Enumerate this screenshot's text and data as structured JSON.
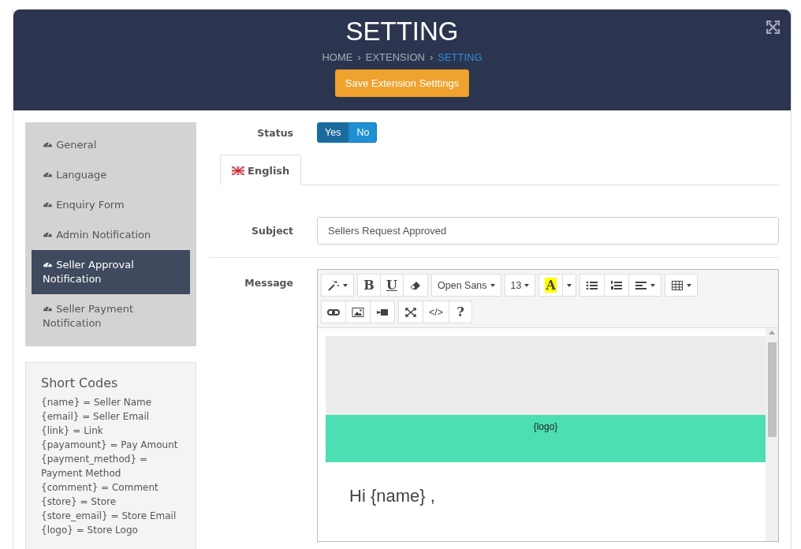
{
  "header": {
    "title": "SETTING",
    "separator": "›",
    "breadcrumb": [
      {
        "label": "HOME",
        "current": false
      },
      {
        "label": "EXTENSION",
        "current": false
      },
      {
        "label": "SETTING",
        "current": true
      }
    ],
    "save_button": "Save Extension Setttings"
  },
  "sidebar": {
    "items": [
      {
        "label": "General",
        "selected": false
      },
      {
        "label": "Language",
        "selected": false
      },
      {
        "label": "Enquiry Form",
        "selected": false
      },
      {
        "label": "Admin Notification",
        "selected": false
      },
      {
        "label": "Seller Approval Notification",
        "selected": true
      },
      {
        "label": "Seller Payment Notification",
        "selected": false
      }
    ]
  },
  "short_codes": {
    "title": "Short Codes",
    "lines": [
      "{name} = Seller Name",
      "{email} = Seller Email",
      "{link} = Link",
      "{payamount} = Pay Amount",
      "{payment_method} = Payment Method",
      "{comment} = Comment",
      "{store} = Store",
      "{store_email} = Store Email",
      "{logo} = Store Logo"
    ]
  },
  "status": {
    "label": "Status",
    "options": [
      {
        "label": "Yes",
        "selected": true
      },
      {
        "label": "No",
        "selected": false
      }
    ]
  },
  "language_tabs": [
    {
      "label": "English",
      "selected": true
    }
  ],
  "subject": {
    "label": "Subject",
    "value": "Sellers Request Approved"
  },
  "message": {
    "label": "Message",
    "toolbar": [
      [
        {
          "kind": "wand",
          "dropdown": true
        }
      ],
      [
        {
          "kind": "bold",
          "label": "B"
        },
        {
          "kind": "underline",
          "label": "U"
        },
        {
          "kind": "eraser"
        }
      ],
      [
        {
          "kind": "text",
          "label": "Open Sans",
          "dropdown": true
        }
      ],
      [
        {
          "kind": "text",
          "label": "13",
          "dropdown": true
        }
      ],
      [
        {
          "kind": "color",
          "label": "A"
        },
        {
          "kind": "caret"
        }
      ],
      [
        {
          "kind": "ul"
        },
        {
          "kind": "ol"
        },
        {
          "kind": "align",
          "dropdown": true
        }
      ],
      [
        {
          "kind": "table",
          "dropdown": true
        }
      ],
      [
        {
          "kind": "link"
        },
        {
          "kind": "image"
        },
        {
          "kind": "video"
        }
      ],
      [
        {
          "kind": "fullscreen"
        },
        {
          "kind": "text",
          "label": "</>"
        },
        {
          "kind": "help",
          "label": "?"
        }
      ]
    ],
    "logo_placeholder": "{logo}",
    "greeting": "Hi {name} ,"
  }
}
